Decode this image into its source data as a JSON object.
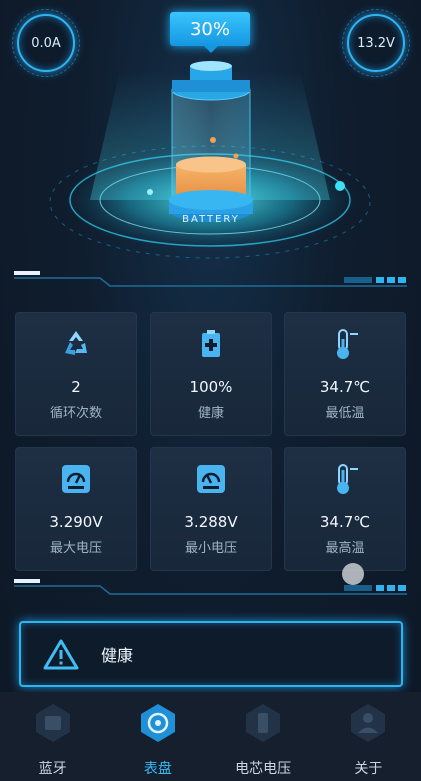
{
  "gauges": {
    "current": "0.0A",
    "voltage": "13.2V"
  },
  "battery": {
    "percent": "30%",
    "label": "BATTERY",
    "level": 0.3
  },
  "cards": [
    {
      "icon": "recycle-icon",
      "value": "2",
      "label": "循环次数"
    },
    {
      "icon": "battery-health-icon",
      "value": "100%",
      "label": "健康"
    },
    {
      "icon": "thermometer-icon",
      "value": "34.7℃",
      "label": "最低温"
    },
    {
      "icon": "meter-icon",
      "value": "3.290V",
      "label": "最大电压"
    },
    {
      "icon": "meter-icon",
      "value": "3.288V",
      "label": "最小电压"
    },
    {
      "icon": "thermometer-icon",
      "value": "34.7℃",
      "label": "最高温"
    }
  ],
  "status": {
    "text": "健康",
    "icon": "warning-icon"
  },
  "nav": [
    {
      "label": "蓝牙",
      "active": false
    },
    {
      "label": "表盘",
      "active": true
    },
    {
      "label": "电芯电压",
      "active": false
    },
    {
      "label": "关于",
      "active": false
    }
  ],
  "colors": {
    "accent": "#2fb4f0",
    "battery_fill": "#f0a152",
    "card_bg": "#1e2f44"
  }
}
